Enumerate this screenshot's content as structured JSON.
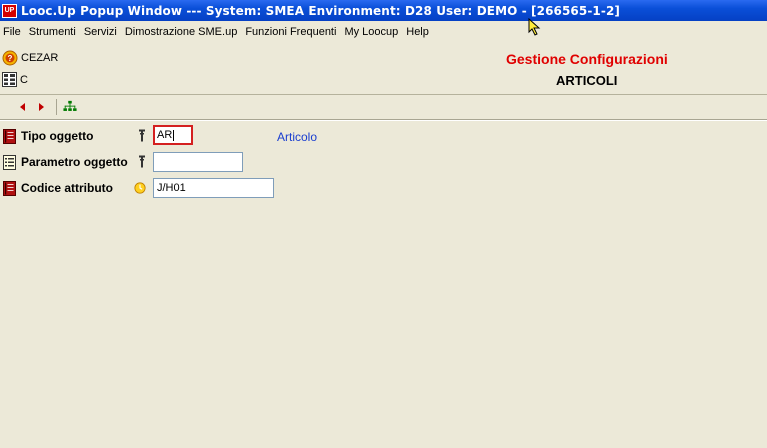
{
  "window": {
    "title": "Looc.Up Popup Window  ---  System: SMEA Environment: D28 User: DEMO - [266565-1-2]",
    "logo_text": "UP"
  },
  "menu": [
    "File",
    "Strumenti",
    "Servizi",
    "Dimostrazione SME.up",
    "Funzioni Frequenti",
    "My Loocup",
    "Help"
  ],
  "header": {
    "user_label": "CEZAR",
    "type_label": "C",
    "panel_title": "Gestione Configurazioni",
    "panel_subtitle": "ARTICOLI"
  },
  "toolbar": {
    "icons": [
      "arrow-left-icon",
      "arrow-right-icon",
      "hierarchy-icon"
    ]
  },
  "form": {
    "fields": [
      {
        "label": "Tipo oggetto",
        "value": "AR",
        "description": "Articolo",
        "icon": "book-red-icon",
        "hint_icon": "pin-icon"
      },
      {
        "label": "Parametro oggetto",
        "value": "",
        "icon": "list-icon",
        "hint_icon": "pin-icon"
      },
      {
        "label": "Codice attributo",
        "value": "J/H01",
        "icon": "book-red-icon",
        "hint_icon": "yellow-circle-icon"
      }
    ]
  },
  "colors": {
    "title_bar": "#0a4fd8",
    "panel_title": "#e00000",
    "description": "#1a3ed0",
    "background": "#ece9d8"
  }
}
